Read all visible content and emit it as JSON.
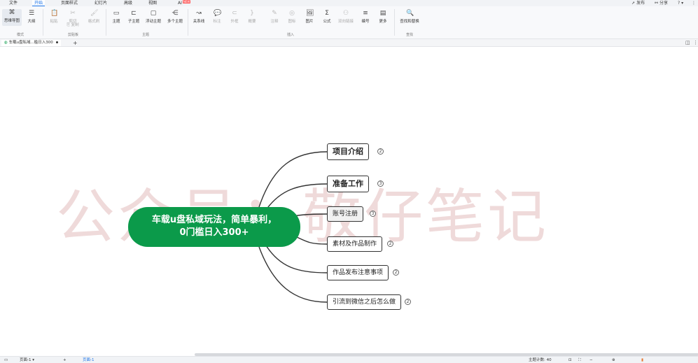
{
  "menubar": {
    "items": [
      "文件",
      "开始",
      "页面样式",
      "幻灯片",
      "高级",
      "视图",
      "AI"
    ],
    "active_index": 1,
    "ai_badge": "NEW",
    "right": {
      "publish": "发布",
      "share": "分享"
    }
  },
  "ribbon": {
    "tools": [
      {
        "label": "思维导图",
        "icon": "mindmap-icon",
        "glyph": "⌘"
      },
      {
        "label": "大纲",
        "icon": "outline-icon",
        "glyph": "☰"
      },
      {
        "label": "粘贴",
        "icon": "paste-icon",
        "glyph": "📋"
      },
      {
        "label": "剪切",
        "icon": "cut-icon",
        "glyph": "✂"
      },
      {
        "label": "复制",
        "icon": "copy-icon",
        "glyph": "⎘"
      },
      {
        "label": "格式刷",
        "icon": "format-painter-icon",
        "glyph": "🖌"
      },
      {
        "label": "主题",
        "icon": "topic-icon",
        "glyph": "▭"
      },
      {
        "label": "子主题",
        "icon": "subtopic-icon",
        "glyph": "⊏"
      },
      {
        "label": "浮动主题",
        "icon": "floating-topic-icon",
        "glyph": "▢"
      },
      {
        "label": "多个主题",
        "icon": "multi-topic-icon",
        "glyph": "⋲"
      },
      {
        "label": "关系线",
        "icon": "relation-line-icon",
        "glyph": "↝"
      },
      {
        "label": "标注",
        "icon": "callout-icon",
        "glyph": "💬"
      },
      {
        "label": "外框",
        "icon": "boundary-icon",
        "glyph": "⊂"
      },
      {
        "label": "概要",
        "icon": "summary-icon",
        "glyph": "}"
      },
      {
        "label": "注释",
        "icon": "note-icon",
        "glyph": "✎"
      },
      {
        "label": "图标",
        "icon": "marker-icon",
        "glyph": "◎"
      },
      {
        "label": "图片",
        "icon": "image-icon",
        "glyph": "🖼"
      },
      {
        "label": "公式",
        "icon": "formula-icon",
        "glyph": "Σ"
      },
      {
        "label": "双向链接",
        "icon": "bidirectional-link-icon",
        "glyph": "⚇"
      },
      {
        "label": "编号",
        "icon": "numbering-icon",
        "glyph": "≡"
      },
      {
        "label": "更多",
        "icon": "more-icon",
        "glyph": "▤"
      },
      {
        "label": "查找和替换",
        "icon": "find-replace-icon",
        "glyph": "🔍"
      }
    ],
    "groups": {
      "mode": "模式",
      "clipboard": "剪贴板",
      "topic": "主题",
      "insert": "插入",
      "find": "查找"
    }
  },
  "tabstrip": {
    "doc_title": "车载u盘私域...槛日入300",
    "new_tab": "+"
  },
  "canvas": {
    "watermark": "公众号：敬仔笔记",
    "root": {
      "line1": "车载u盘私域玩法，简单暴利，",
      "line2": "0门槛日入300+"
    },
    "children": [
      {
        "label": "项目介绍",
        "count": "2"
      },
      {
        "label": "准备工作",
        "count": "3"
      },
      {
        "label": "账号注册",
        "count": "3"
      },
      {
        "label": "素材及作品制作",
        "count": "2"
      },
      {
        "label": "作品发布注意事项",
        "count": "2"
      },
      {
        "label": "引流到微信之后怎么做",
        "count": "2"
      }
    ],
    "colors": {
      "root_fill": "#0b9a4a",
      "line": "#333333",
      "watermark": "#cd8c8c"
    }
  },
  "statusbar": {
    "page_selector": "页面-1",
    "add_page": "+",
    "page_tab": "页面-1",
    "topic_count": "主题计数: 40"
  }
}
